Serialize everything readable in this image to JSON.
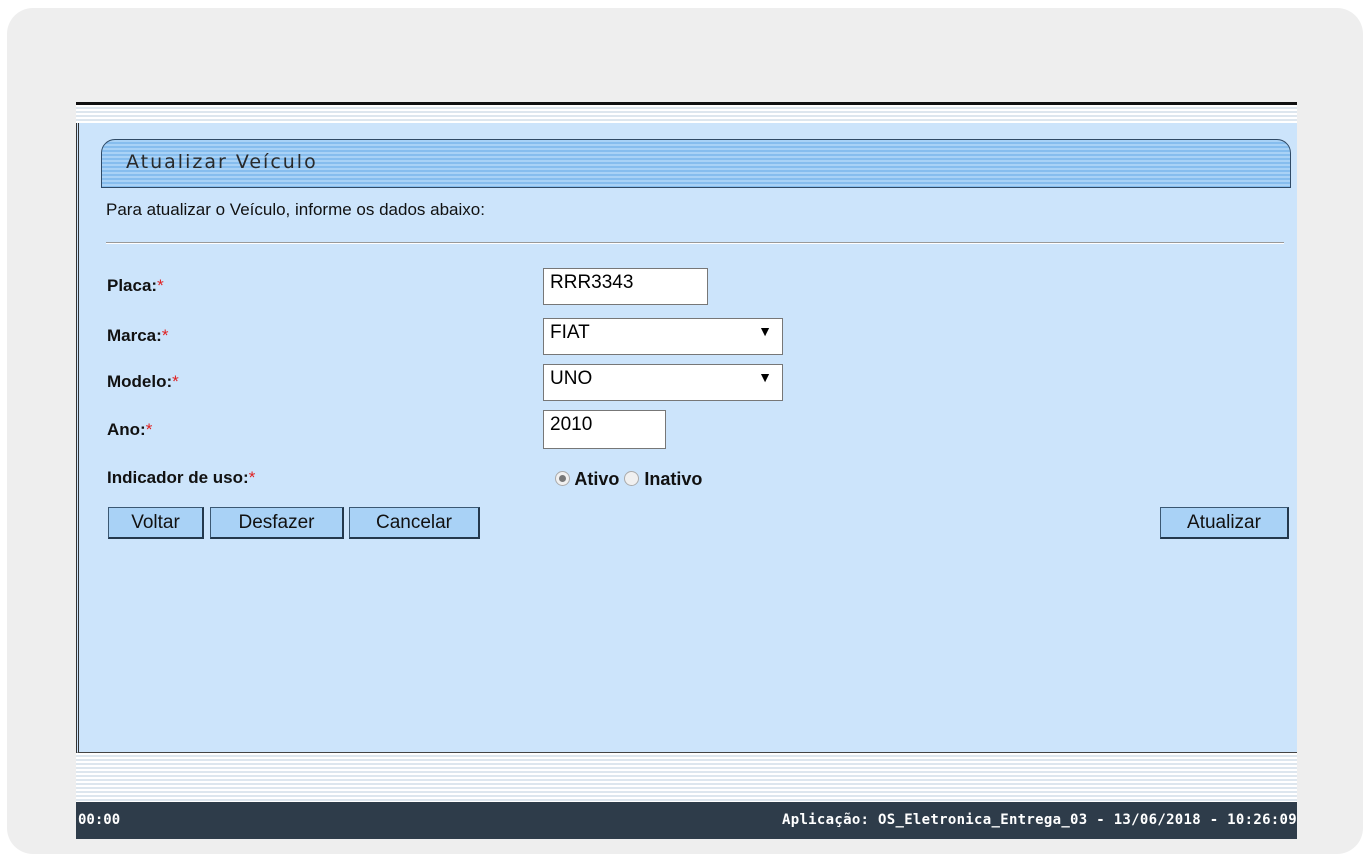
{
  "header": {
    "title": "Atualizar Veículo",
    "subtitle": "Para atualizar o Veículo, informe os dados abaixo:"
  },
  "form": {
    "required_mark": "*",
    "placa": {
      "label": "Placa:",
      "value": "RRR3343"
    },
    "marca": {
      "label": "Marca:",
      "value": "FIAT"
    },
    "modelo": {
      "label": "Modelo:",
      "value": "UNO"
    },
    "ano": {
      "label": "Ano:",
      "value": "2010"
    },
    "indicador": {
      "label": "Indicador de uso:",
      "options": [
        "Ativo",
        "Inativo"
      ],
      "selected": "Ativo"
    },
    "dropdown_icon": "triangle-down"
  },
  "buttons": {
    "voltar": "Voltar",
    "desfazer": "Desfazer",
    "cancelar": "Cancelar",
    "atualizar": "Atualizar"
  },
  "status_bar": {
    "left": "00:00",
    "right": "Aplicação: OS_Eletronica_Entrega_03 - 13/06/2018 - 10:26:09"
  }
}
